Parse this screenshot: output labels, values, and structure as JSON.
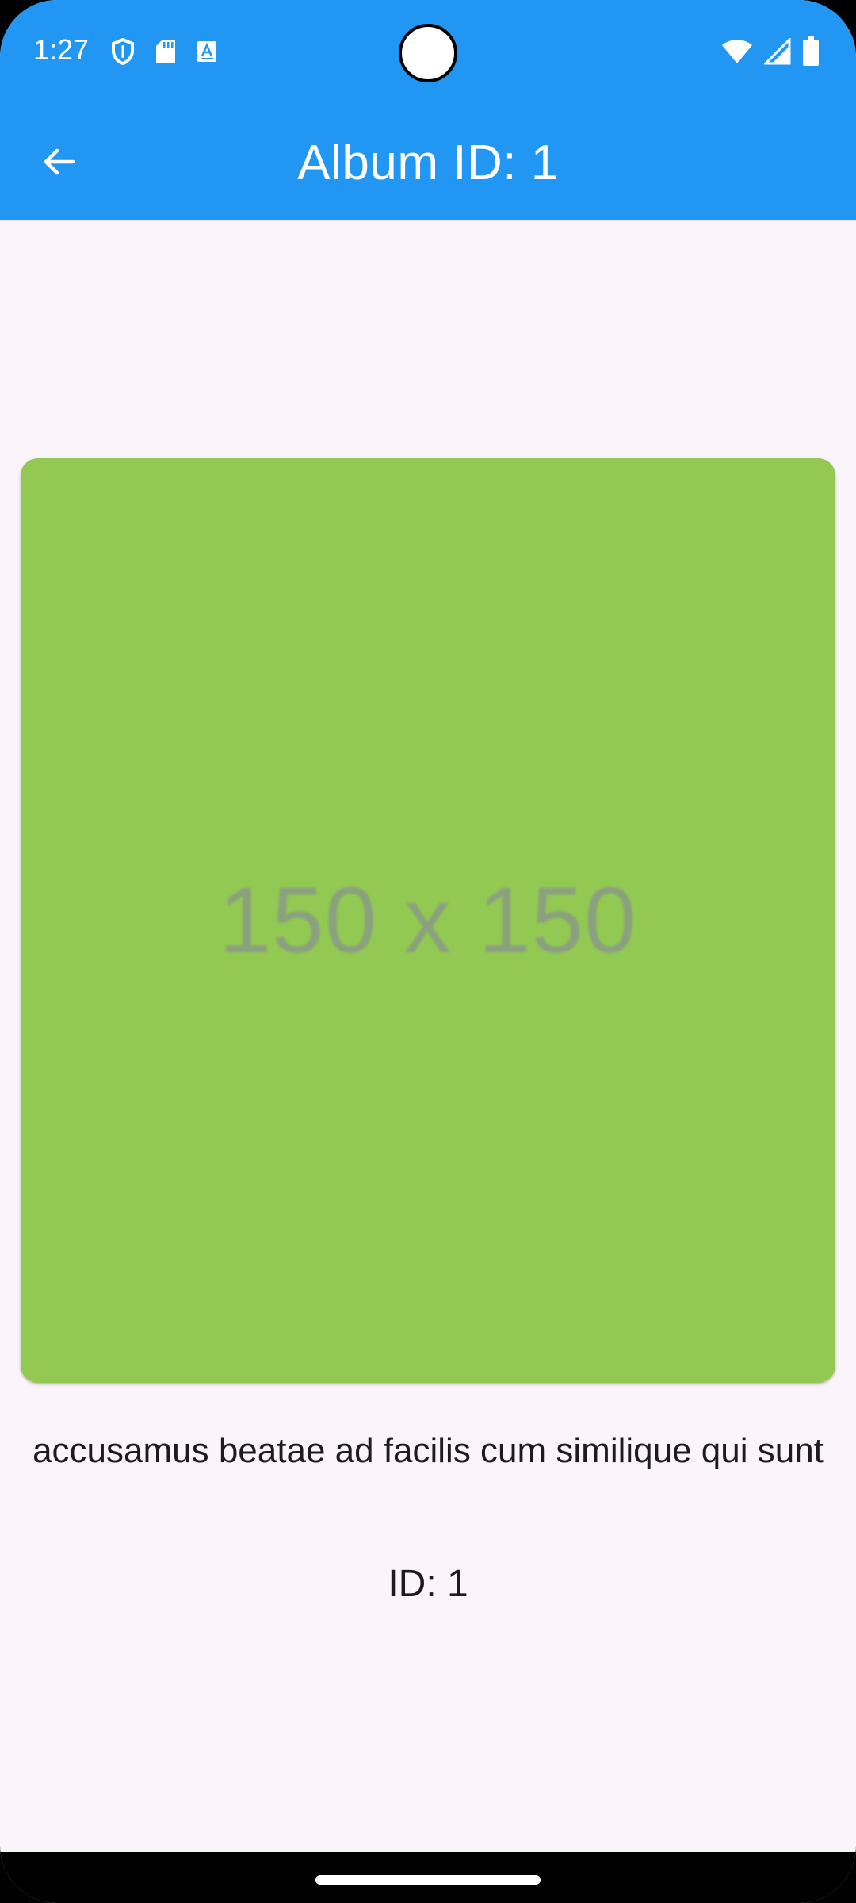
{
  "status_bar": {
    "time": "1:27",
    "left_icons": [
      "shield-icon",
      "sd-card-icon",
      "keyboard-a-icon"
    ],
    "right_icons": [
      "wifi-icon",
      "signal-icon",
      "battery-icon"
    ]
  },
  "app_bar": {
    "title": "Album ID: 1",
    "back_icon": "arrow-back-icon"
  },
  "photo": {
    "placeholder_text": "150 x 150",
    "color": "#92c952",
    "title": "accusamus beatae ad facilis cum similique qui sunt",
    "id_label": "ID: 1"
  },
  "colors": {
    "primary": "#2196f3",
    "background": "#fbf4fb",
    "text": "#1d1b20"
  }
}
